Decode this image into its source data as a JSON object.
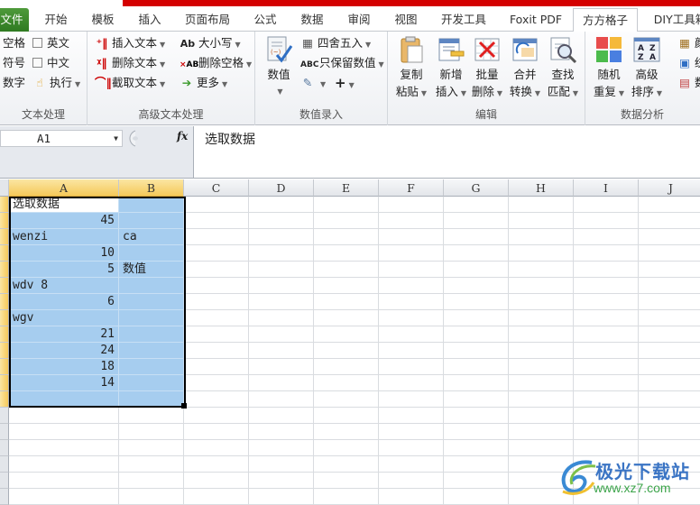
{
  "ribbon_tabs": [
    {
      "label": "文件",
      "type": "file"
    },
    {
      "label": "开始"
    },
    {
      "label": "模板"
    },
    {
      "label": "插入"
    },
    {
      "label": "页面布局"
    },
    {
      "label": "公式"
    },
    {
      "label": "数据"
    },
    {
      "label": "审阅"
    },
    {
      "label": "视图"
    },
    {
      "label": "开发工具"
    },
    {
      "label": "Foxit PDF"
    },
    {
      "label": "方方格子",
      "active": true
    },
    {
      "label": "DIY工具箱"
    }
  ],
  "groups": {
    "text_processing": {
      "label": "文本处理",
      "items": {
        "space": "空格",
        "symbol": "符号",
        "digit": "数字",
        "english": "英文",
        "chinese": "中文",
        "execute": "执行"
      }
    },
    "advanced_text": {
      "label": "高级文本处理",
      "items": {
        "insert_text": "插入文本",
        "delete_text": "删除文本",
        "extract_text": "截取文本",
        "case": "大小写",
        "delete_space": "删除空格",
        "more": "更多"
      }
    },
    "numeric_entry": {
      "label": "数值录入",
      "items": {
        "value": "数值",
        "round": "四舍五入",
        "keep_numeric": "只保留数值",
        "plus": "+"
      }
    },
    "edit": {
      "label": "编辑",
      "items": {
        "copy_paste": [
          "复制",
          "粘贴"
        ],
        "new_insert": [
          "新增",
          "插入"
        ],
        "batch_delete": [
          "批量",
          "删除"
        ],
        "merge_convert": [
          "合并",
          "转换"
        ],
        "find_match": [
          "查找",
          "匹配"
        ]
      }
    },
    "data_analysis": {
      "label": "数据分析",
      "items": {
        "random_repeat": [
          "随机",
          "重复"
        ],
        "advanced_sort": [
          "高级",
          "排序"
        ],
        "small1": "颜",
        "small2": "统",
        "small3": "数"
      }
    }
  },
  "formula_bar": {
    "name_box": "A1",
    "fx_label": "fx",
    "content": "选取数据"
  },
  "columns": [
    "A",
    "B",
    "C",
    "D",
    "E",
    "F",
    "G",
    "H",
    "I",
    "J"
  ],
  "cells": [
    {
      "row": 1,
      "A": "选取数据",
      "A_num": false,
      "B": ""
    },
    {
      "row": 2,
      "A": "45",
      "A_num": true,
      "B": ""
    },
    {
      "row": 3,
      "A": "wenzi",
      "A_num": false,
      "B": "ca"
    },
    {
      "row": 4,
      "A": "10",
      "A_num": true,
      "B": ""
    },
    {
      "row": 5,
      "A": "5",
      "A_num": true,
      "B": "数值"
    },
    {
      "row": 6,
      "A": "wdv 8",
      "A_num": false,
      "B": ""
    },
    {
      "row": 7,
      "A": "6",
      "A_num": true,
      "B": ""
    },
    {
      "row": 8,
      "A": "wgv",
      "A_num": false,
      "B": ""
    },
    {
      "row": 9,
      "A": "21",
      "A_num": true,
      "B": ""
    },
    {
      "row": 10,
      "A": "24",
      "A_num": true,
      "B": ""
    },
    {
      "row": 11,
      "A": "18",
      "A_num": true,
      "B": ""
    },
    {
      "row": 12,
      "A": "14",
      "A_num": true,
      "B": ""
    },
    {
      "row": 13,
      "A": "",
      "A_num": false,
      "B": ""
    }
  ],
  "selection": {
    "range": "A1:B13",
    "active_cell": "A1"
  },
  "watermark": {
    "title": "极光下载站",
    "url": "www.xz7.com"
  },
  "colors": {
    "accent_red": "#d40000",
    "file_tab_green": "#3c8a2c",
    "selection_fill": "#a6cdef",
    "header_selected": "#f5c95a"
  }
}
